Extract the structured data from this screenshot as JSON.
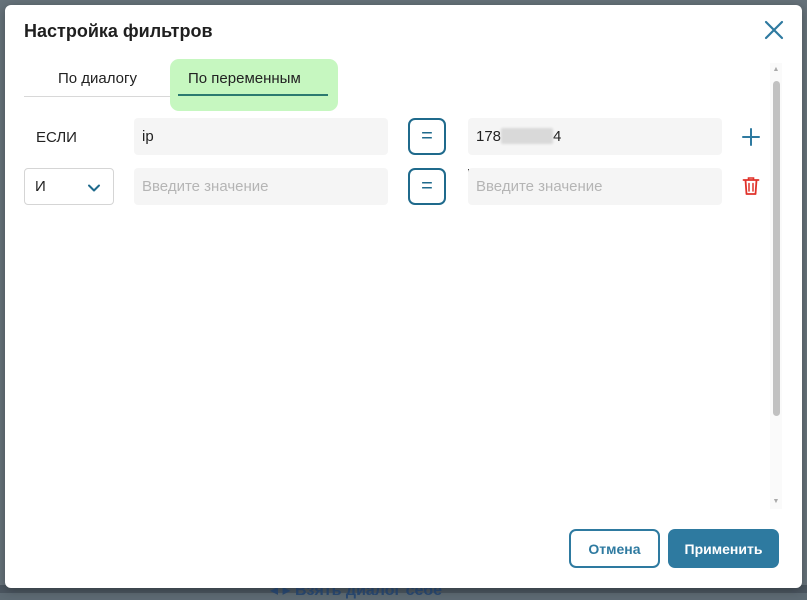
{
  "dialog": {
    "title": "Настройка фильтров",
    "close_icon": "close-icon"
  },
  "tabs": [
    {
      "label": "По диалогу",
      "active": false
    },
    {
      "label": "По переменным",
      "active": true
    }
  ],
  "filters": {
    "condition_label": "ЕСЛИ",
    "rows": [
      {
        "variable_value": "ip",
        "operator": "=",
        "value_prefix": "178",
        "value_suffix": "4",
        "action_icon": "plus-icon"
      },
      {
        "logic_operator": "И",
        "variable_placeholder": "Введите значение",
        "operator": "=",
        "value_placeholder": "Введите значение",
        "action_icon": "trash-icon"
      }
    ]
  },
  "buttons": {
    "cancel_label": "Отмена",
    "apply_label": "Применить"
  },
  "background": {
    "partial_text": "◂ ▸ Взять диалог себе"
  },
  "colors": {
    "accent": "#2e7aa0",
    "active_tab_bg": "#c6f7c0",
    "active_tab_underline": "#2c7a70",
    "delete_red": "#e0322a"
  }
}
